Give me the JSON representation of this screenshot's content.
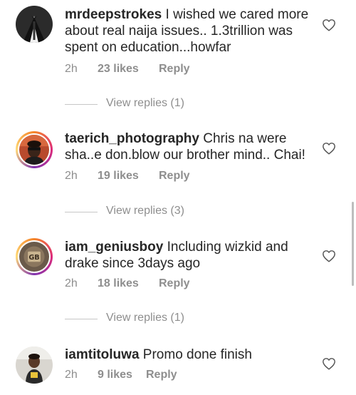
{
  "comments": [
    {
      "username": "mrdeepstrokes",
      "text": " I wished we cared more about real naija issues.. 1.3trillion was spent on education...howfar",
      "time": "2h",
      "likes": "23 likes",
      "reply": "Reply",
      "view_replies": "View replies (1)",
      "avatar_icon": "tuxedo-avatar-icon"
    },
    {
      "username": "taerich_photography",
      "text": " Chris na were sha..e don.blow our brother mind.. Chai!",
      "time": "2h",
      "likes": "19 likes",
      "reply": "Reply",
      "view_replies": "View replies (3)",
      "avatar_icon": "person-avatar-icon"
    },
    {
      "username": "iam_geniusboy",
      "text": " Including wizkid and drake since 3days ago",
      "time": "2h",
      "likes": "18 likes",
      "reply": "Reply",
      "view_replies": "View replies (1)",
      "avatar_icon": "gb-logo-avatar-icon"
    },
    {
      "username": "iamtitoluwa",
      "text": " Promo done finish",
      "time": "2h",
      "likes": "9 likes",
      "reply": "Reply",
      "avatar_icon": "child-avatar-icon"
    }
  ],
  "icons": {
    "like": "heart-outline-icon"
  },
  "colors": {
    "text": "#262626",
    "muted": "#8e8e8e",
    "story_ring_start": "#f58529",
    "story_ring_end": "#dd2a7b"
  }
}
